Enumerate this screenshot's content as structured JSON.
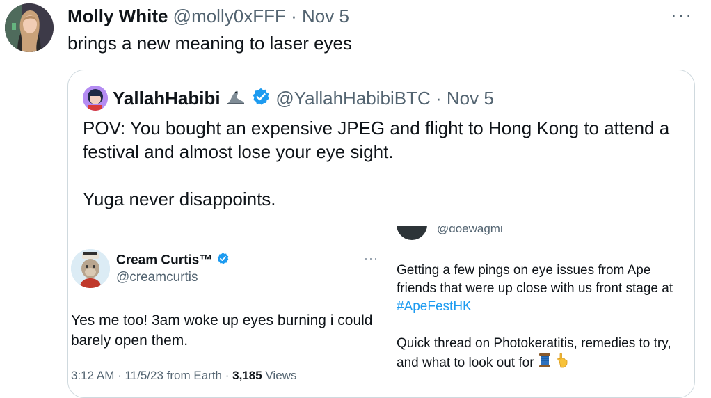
{
  "tweet": {
    "author_name": "Molly White",
    "handle": "@molly0xFFF",
    "separator": "·",
    "date": "Nov 5",
    "more": "···",
    "text": "brings a new meaning to laser eyes"
  },
  "quote": {
    "author_name": "YallahHabibi",
    "handle": "@YallahHabibiBTC",
    "separator": "·",
    "date": "Nov 5",
    "text_line1": "POV: You bought an expensive JPEG and flight to Hong Kong to attend a festival and almost lose your eye sight.",
    "text_line2": "Yuga never disappoints."
  },
  "media_left": {
    "author_name": "Cream Curtis™",
    "handle": "@creamcurtis",
    "more": "···",
    "body": "Yes me too! 3am woke up eyes burning i could barely open them.",
    "meta_prefix": "3:12 AM · 11/5/23 from Earth · ",
    "views_count": "3,185",
    "views_label": " Views"
  },
  "media_right": {
    "handle": "@doewagmi",
    "body_pre": "Getting a few pings on eye issues from Ape friends that were up close with us front stage at ",
    "hashtag": "#ApeFestHK",
    "body2": "Quick thread on Photokeratitis, remedies to try, and what to look out for"
  },
  "colors": {
    "accent": "#1d9bf0",
    "muted": "#536471",
    "border": "#cfd9de",
    "text": "#0f1419"
  }
}
